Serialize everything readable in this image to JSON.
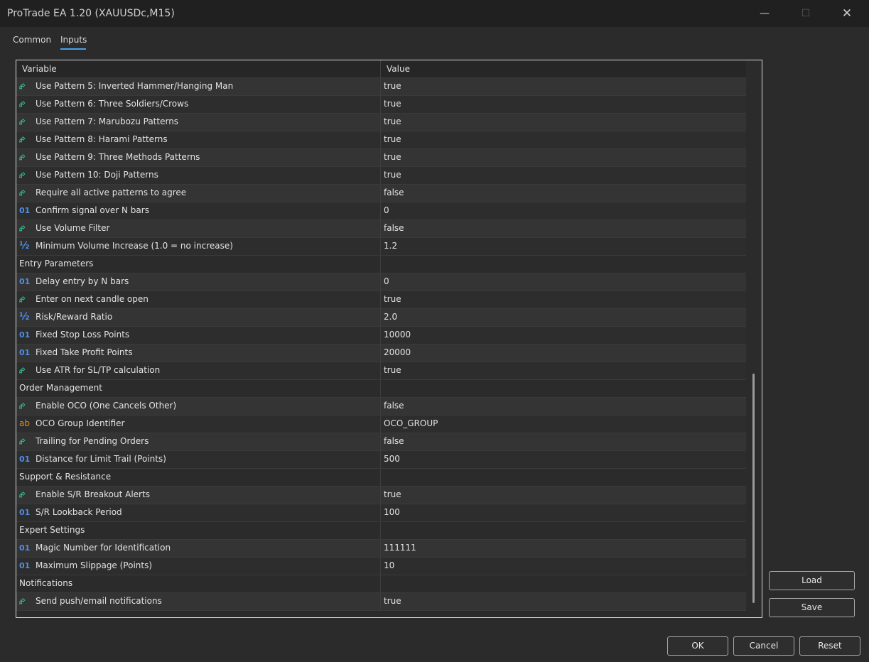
{
  "window": {
    "title": "ProTrade EA 1.20 (XAUUSDc,M15)",
    "minimize": "—",
    "maximize": "☐",
    "close": "✕"
  },
  "tabs": {
    "common": "Common",
    "inputs": "Inputs",
    "active": "Inputs"
  },
  "table": {
    "headers": {
      "variable": "Variable",
      "value": "Value"
    },
    "icon_types": {
      "bool": "⮳",
      "int": "01",
      "dbl": "½",
      "str": "ab"
    },
    "rows": [
      {
        "type": "bool",
        "variable": "Use Pattern 5: Inverted Hammer/Hanging Man",
        "value": "true"
      },
      {
        "type": "bool",
        "variable": "Use Pattern 6: Three Soldiers/Crows",
        "value": "true"
      },
      {
        "type": "bool",
        "variable": "Use Pattern 7: Marubozu Patterns",
        "value": "true"
      },
      {
        "type": "bool",
        "variable": "Use Pattern 8: Harami Patterns",
        "value": "true"
      },
      {
        "type": "bool",
        "variable": "Use Pattern 9: Three Methods Patterns",
        "value": "true"
      },
      {
        "type": "bool",
        "variable": "Use Pattern 10: Doji Patterns",
        "value": "true"
      },
      {
        "type": "bool",
        "variable": "Require all active patterns to agree",
        "value": "false"
      },
      {
        "type": "int",
        "variable": "Confirm signal over N bars",
        "value": "0"
      },
      {
        "type": "bool",
        "variable": "Use Volume Filter",
        "value": "false"
      },
      {
        "type": "dbl",
        "variable": "Minimum Volume Increase (1.0 = no increase)",
        "value": "1.2"
      },
      {
        "type": "section",
        "variable": "Entry Parameters",
        "value": ""
      },
      {
        "type": "int",
        "variable": "Delay entry by N bars",
        "value": "0"
      },
      {
        "type": "bool",
        "variable": "Enter on next candle open",
        "value": "true"
      },
      {
        "type": "dbl",
        "variable": "Risk/Reward Ratio",
        "value": "2.0"
      },
      {
        "type": "int",
        "variable": "Fixed Stop Loss Points",
        "value": "10000"
      },
      {
        "type": "int",
        "variable": "Fixed Take Profit Points",
        "value": "20000"
      },
      {
        "type": "bool",
        "variable": "Use ATR for SL/TP calculation",
        "value": "true"
      },
      {
        "type": "section",
        "variable": "Order Management",
        "value": ""
      },
      {
        "type": "bool",
        "variable": "Enable OCO (One Cancels Other)",
        "value": "false"
      },
      {
        "type": "str",
        "variable": "OCO Group Identifier",
        "value": "OCO_GROUP"
      },
      {
        "type": "bool",
        "variable": "Trailing for Pending Orders",
        "value": "false"
      },
      {
        "type": "int",
        "variable": "Distance for Limit Trail (Points)",
        "value": "500"
      },
      {
        "type": "section",
        "variable": "Support & Resistance",
        "value": ""
      },
      {
        "type": "bool",
        "variable": "Enable S/R Breakout Alerts",
        "value": "true"
      },
      {
        "type": "int",
        "variable": "S/R Lookback Period",
        "value": "100"
      },
      {
        "type": "section",
        "variable": "Expert Settings",
        "value": ""
      },
      {
        "type": "int",
        "variable": "Magic Number for Identification",
        "value": "111111"
      },
      {
        "type": "int",
        "variable": "Maximum Slippage (Points)",
        "value": "10"
      },
      {
        "type": "section",
        "variable": "Notifications",
        "value": ""
      },
      {
        "type": "bool",
        "variable": "Send push/email notifications",
        "value": "true"
      }
    ]
  },
  "buttons": {
    "load": "Load",
    "save": "Save",
    "ok": "OK",
    "cancel": "Cancel",
    "reset": "Reset"
  },
  "colors": {
    "accent": "#4a9fe8",
    "bool_icon": "#2fc49a",
    "int_icon": "#4d8fe6",
    "str_icon": "#d88a2a"
  }
}
